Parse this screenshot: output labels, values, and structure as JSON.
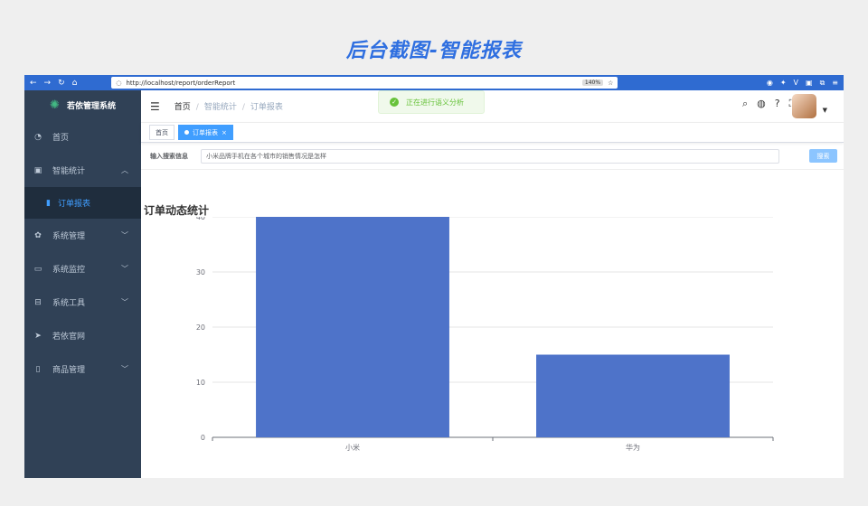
{
  "banner": "后台截图-智能报表",
  "browser": {
    "url": "http://localhost/report/orderReport",
    "zoom": "140%"
  },
  "sidebar": {
    "app_name": "若依管理系统",
    "items": [
      {
        "label": "首页",
        "icon": "dashboard-icon"
      },
      {
        "label": "智能统计",
        "icon": "chart-icon",
        "expanded": true
      },
      {
        "label": "订单报表",
        "icon": "bar-chart-icon",
        "active": true
      },
      {
        "label": "系统管理",
        "icon": "gear-icon"
      },
      {
        "label": "系统监控",
        "icon": "monitor-icon"
      },
      {
        "label": "系统工具",
        "icon": "toolbox-icon"
      },
      {
        "label": "若依官网",
        "icon": "send-icon"
      },
      {
        "label": "商品管理",
        "icon": "phone-icon"
      }
    ]
  },
  "navbar": {
    "breadcrumb": [
      "首页",
      "智能统计",
      "订单报表"
    ]
  },
  "toast": "正在进行语义分析",
  "tags": {
    "home": "首页",
    "current": "订单报表"
  },
  "search": {
    "label": "输入搜索信息",
    "value": "小米品牌手机在各个城市的销售情况是怎样",
    "button": "搜索"
  },
  "chart_data": {
    "type": "bar",
    "title": "订单动态统计",
    "categories": [
      "小米",
      "华为"
    ],
    "values": [
      40,
      15
    ],
    "ylim": [
      0,
      40
    ],
    "yticks": [
      0,
      10,
      20,
      30,
      40
    ],
    "grid": true,
    "bar_color": "#4e73c9"
  }
}
